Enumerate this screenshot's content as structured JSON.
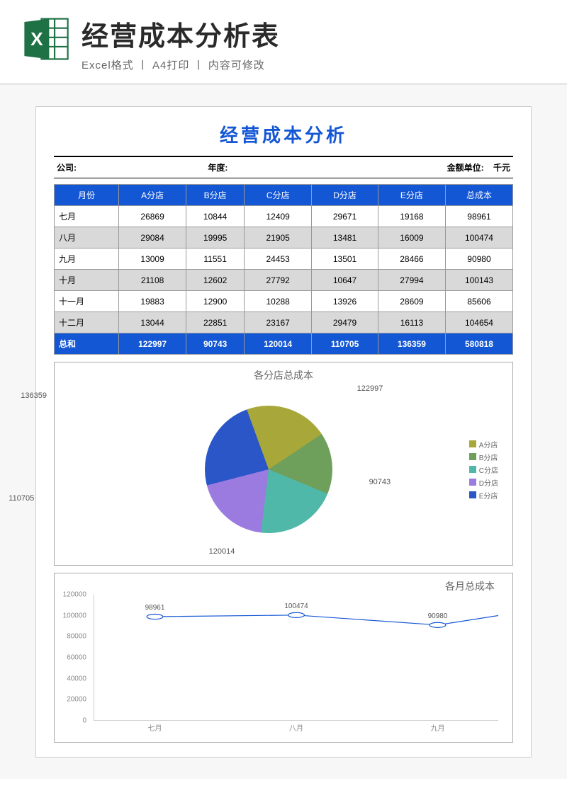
{
  "banner": {
    "title": "经营成本分析表",
    "subtitle": "Excel格式 丨 A4打印 丨 内容可修改"
  },
  "doc": {
    "title": "经营成本分析",
    "meta_company": "公司:",
    "meta_year": "年度:",
    "meta_unit_label": "金额单位:",
    "meta_unit_value": "千元"
  },
  "table": {
    "headers": [
      "月份",
      "A分店",
      "B分店",
      "C分店",
      "D分店",
      "E分店",
      "总成本"
    ],
    "rows": [
      [
        "七月",
        "26869",
        "10844",
        "12409",
        "29671",
        "19168",
        "98961"
      ],
      [
        "八月",
        "29084",
        "19995",
        "21905",
        "13481",
        "16009",
        "100474"
      ],
      [
        "九月",
        "13009",
        "11551",
        "24453",
        "13501",
        "28466",
        "90980"
      ],
      [
        "十月",
        "21108",
        "12602",
        "27792",
        "10647",
        "27994",
        "100143"
      ],
      [
        "十一月",
        "19883",
        "12900",
        "10288",
        "13926",
        "28609",
        "85606"
      ],
      [
        "十二月",
        "13044",
        "22851",
        "23167",
        "29479",
        "16113",
        "104654"
      ]
    ],
    "total": [
      "总和",
      "122997",
      "90743",
      "120014",
      "110705",
      "136359",
      "580818"
    ]
  },
  "chart_data": [
    {
      "type": "pie",
      "title": "各分店总成本",
      "series": [
        {
          "name": "A分店",
          "value": 122997,
          "color": "#a8a83a"
        },
        {
          "name": "B分店",
          "value": 90743,
          "color": "#6fa05b"
        },
        {
          "name": "C分店",
          "value": 120014,
          "color": "#4fb8a8"
        },
        {
          "name": "D分店",
          "value": 110705,
          "color": "#9b7be0"
        },
        {
          "name": "E分店",
          "value": 136359,
          "color": "#2a56c8"
        }
      ],
      "legend_position": "right"
    },
    {
      "type": "line",
      "title": "各月总成本",
      "x": [
        "七月",
        "八月",
        "九月"
      ],
      "values": [
        98961,
        100474,
        90980
      ],
      "ylim": [
        0,
        120000
      ],
      "yticks": [
        0,
        20000,
        40000,
        60000,
        80000,
        100000,
        120000
      ],
      "color": "#1457d4"
    }
  ]
}
